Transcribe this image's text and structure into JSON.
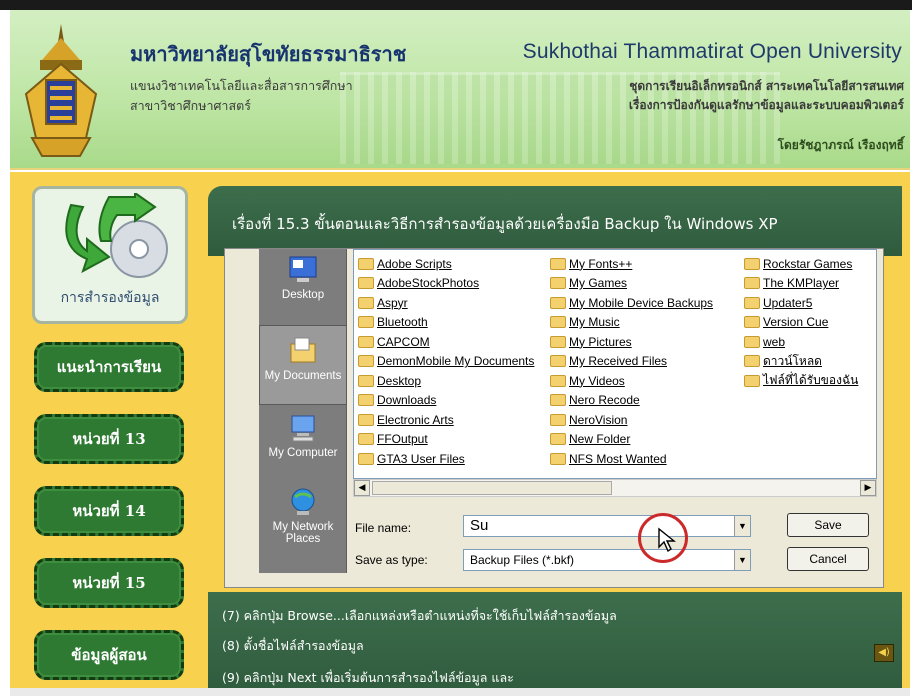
{
  "header": {
    "university_th": "มหาวิทยาลัยสุโขทัยธรรมาธิราช",
    "university_en": "Sukhothai Thammatirat Open University",
    "department_th_1": "แขนงวิชาเทคโนโลยีและสื่อสารการศึกษา",
    "department_th_2": "สาขาวิชาศึกษาศาสตร์",
    "course_line_1": "ชุดการเรียนอิเล็กทรอนิกส์ สาระเทคโนโลยีสารสนเทศ",
    "course_line_2": "เรื่องการป้องกันดูแลรักษาข้อมูลและระบบคอมพิวเตอร์",
    "author": "โดยรัชฎาภรณ์ เรืองฤทธิ์"
  },
  "sidebar": {
    "topic_label": "การสำรองข้อมูล",
    "items": [
      {
        "label": "แนะนำการเรียน"
      },
      {
        "label": "หน่วยที่ 13"
      },
      {
        "label": "หน่วยที่ 14"
      },
      {
        "label": "หน่วยที่ 15"
      },
      {
        "label": "ข้อมูลผู้สอน"
      }
    ]
  },
  "main": {
    "title": "เรื่องที่ 15.3 ขั้นตอนและวิธีการสำรองข้อมูลด้วยเครื่องมือ Backup ใน Windows XP",
    "places": [
      {
        "label": "Desktop",
        "icon": "desktop-icon"
      },
      {
        "label": "My Documents",
        "icon": "my-documents-icon"
      },
      {
        "label": "My Computer",
        "icon": "my-computer-icon"
      },
      {
        "label": "My Network Places",
        "icon": "network-places-icon"
      }
    ],
    "folders_col1": [
      "Adobe Scripts",
      "AdobeStockPhotos",
      "Aspyr",
      "Bluetooth",
      "CAPCOM",
      "DemonMobile My Documents",
      "Desktop",
      "Downloads",
      "Electronic Arts",
      "FFOutput",
      "GTA3 User Files"
    ],
    "folders_col2": [
      "My Fonts++",
      "My Games",
      "My Mobile Device Backups",
      "My Music",
      "My Pictures",
      "My Received Files",
      "My Videos",
      "Nero Recode",
      "NeroVision",
      "New Folder",
      "NFS Most Wanted"
    ],
    "folders_col3": [
      "Rockstar Games",
      "The KMPlayer",
      "Updater5",
      "Version Cue",
      "web",
      "ดาวน์โหลด",
      "ไฟล์ที่ได้รับของฉัน"
    ],
    "file_name_label": "File name:",
    "file_name_value": "Su",
    "save_type_label": "Save as type:",
    "save_type_value": "Backup Files (*.bkf)",
    "save_button": "Save",
    "cancel_button": "Cancel",
    "steps": [
      "(7) คลิกปุ่ม Browse...เลือกแหล่งหรือตำแหน่งที่จะใช้เก็บไฟล์สำรองข้อมูล",
      "(8) ตั้งชื่อไฟล์สำรองข้อมูล",
      "(9) คลิกปุ่ม Next เพื่อเริ่มต้นการสำรองไฟล์ข้อมูล และ"
    ]
  },
  "colors": {
    "header_green": "#bfe6a6",
    "body_yellow": "#f8d14e",
    "nav_green": "#2f7a32",
    "band_green": "#2f5b3d"
  }
}
